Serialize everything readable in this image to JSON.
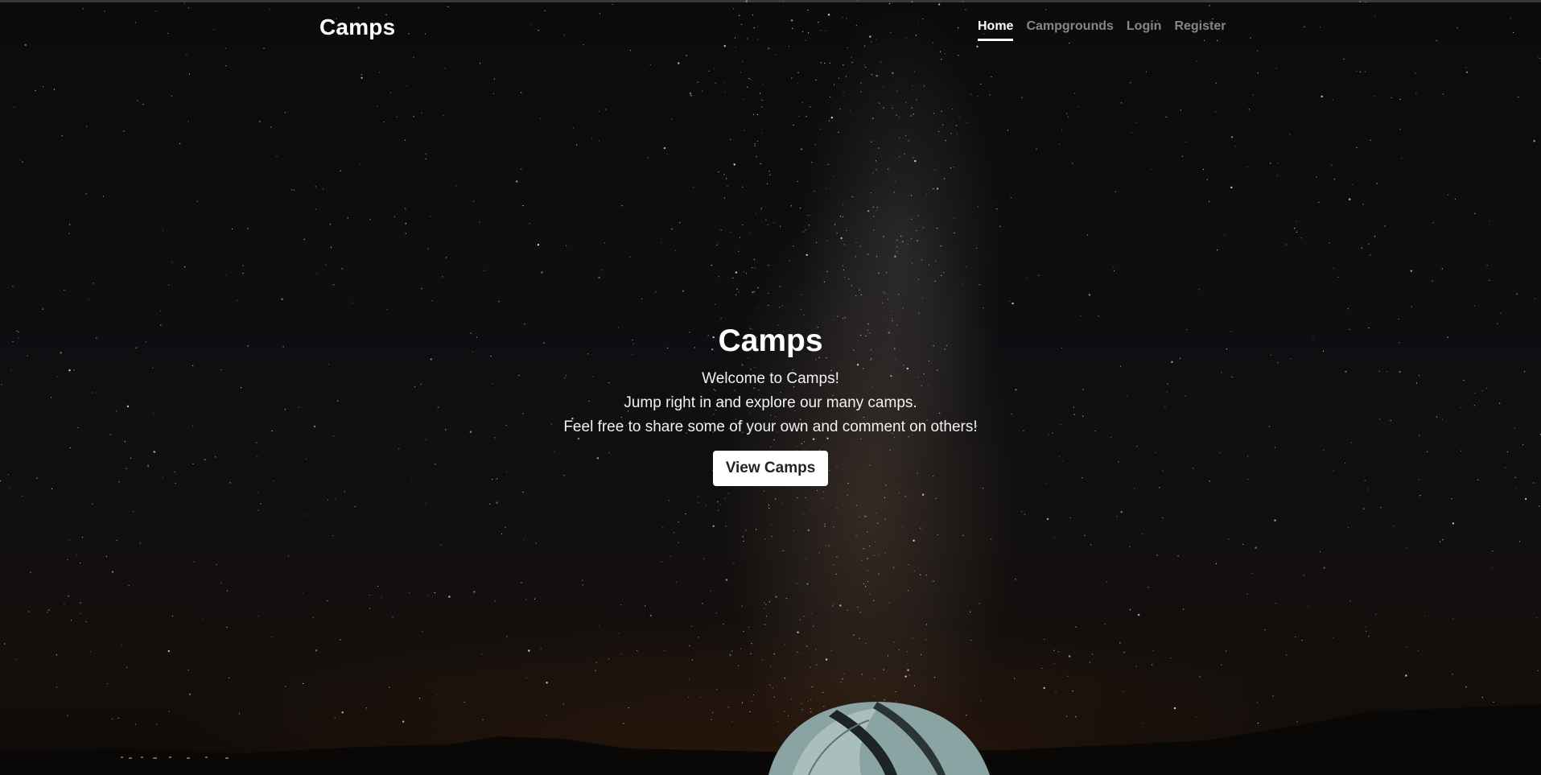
{
  "navbar": {
    "brand": "Camps",
    "links": [
      {
        "label": "Home",
        "active": true
      },
      {
        "label": "Campgrounds",
        "active": false
      },
      {
        "label": "Login",
        "active": false
      },
      {
        "label": "Register",
        "active": false
      }
    ]
  },
  "hero": {
    "title": "Camps",
    "lines": [
      "Welcome to Camps!",
      "Jump right in and explore our many camps.",
      "Feel free to share some of your own and comment on others!"
    ],
    "button_label": "View Camps"
  },
  "background": {
    "subject": "night-sky-tent-icon"
  },
  "colors": {
    "text": "#ffffff",
    "nav_inactive": "rgba(255,255,255,0.5)",
    "button_bg": "#ffffff",
    "button_text": "#212529"
  }
}
